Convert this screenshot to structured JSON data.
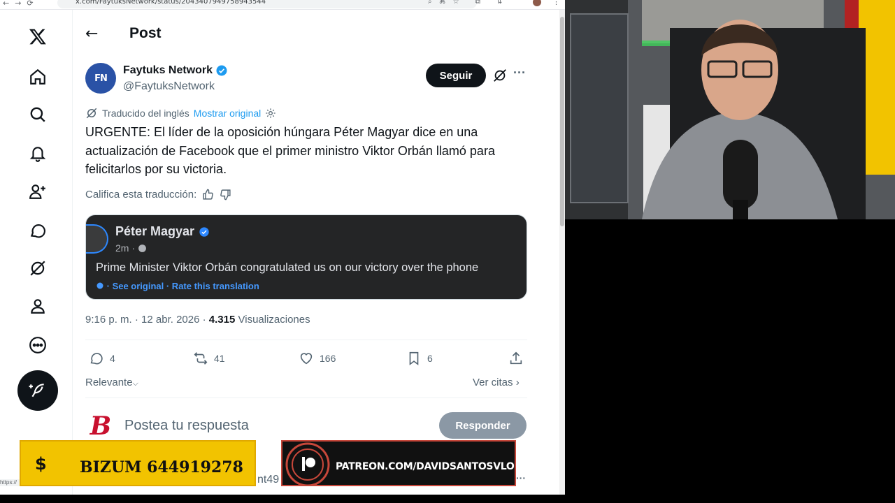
{
  "browser": {
    "url": "x.com/FaytuksNetwork/status/2043407949758943544"
  },
  "post": {
    "header_title": "Post",
    "author_name": "Faytuks Network",
    "author_handle": "@FaytuksNetwork",
    "author_avatar_text": "FN",
    "follow_label": "Seguir",
    "translated_label": "Traducido del inglés",
    "show_original_label": "Mostrar original",
    "text": "URGENTE: El líder de la oposición húngara Péter Magyar dice en una actualización de Facebook que el primer ministro Viktor Orbán llamó para felicitarlos por su victoria.",
    "rate_translation_label": "Califica esta traducción:",
    "embed": {
      "name": "Péter Magyar",
      "time": "2m ·",
      "text": "Prime Minister Viktor Orbán congratulated us on our victory over the phone",
      "links": "· See original · Rate this translation"
    },
    "time_date": "9:16 p. m. · 12 abr. 2026 ·",
    "views_count": "4.315",
    "views_label": "Visualizaciones",
    "actions": {
      "replies": "4",
      "reposts": "41",
      "likes": "166",
      "bookmarks": "6"
    },
    "sort_label": "Relevante",
    "quotes_label": "Ver citas",
    "reply_placeholder": "Postea tu respuesta",
    "reply_button": "Responder",
    "reply_avatar_text": "B",
    "peek_text": "nt49"
  },
  "overlays": {
    "bizum_symbol": "$",
    "bizum_text": "BIZUM 644919278",
    "patreon_text": "PATREON.COM/DAVIDSANTOSVLOG",
    "status_url": "https://"
  },
  "colors": {
    "accent": "#1d9bf0",
    "text_primary": "#0f1419",
    "text_secondary": "#536471",
    "bizum_bg": "#f2c300",
    "patreon_border": "#c7473a"
  }
}
